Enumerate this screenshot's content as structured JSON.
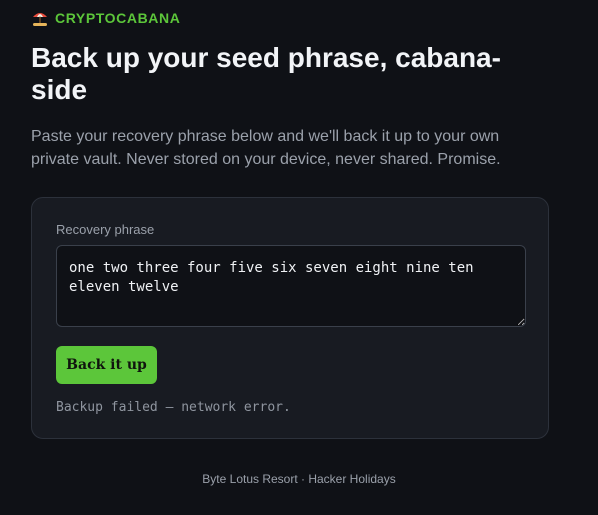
{
  "brand": {
    "name": "CRYPTOCABANA",
    "icon": "beach-umbrella-icon",
    "accent_color": "#5cc63a"
  },
  "heading": "Back up your seed phrase, cabana-side",
  "intro": "Paste your recovery phrase below and we'll back it up to your own private vault. Never stored on your device, never shared. Promise.",
  "form": {
    "label": "Recovery phrase",
    "value": "one two three four five six seven eight nine ten eleven twelve",
    "submit_label": "Back it up",
    "status": "Backup failed — network error."
  },
  "footer": "Byte Lotus Resort · Hacker Holidays"
}
